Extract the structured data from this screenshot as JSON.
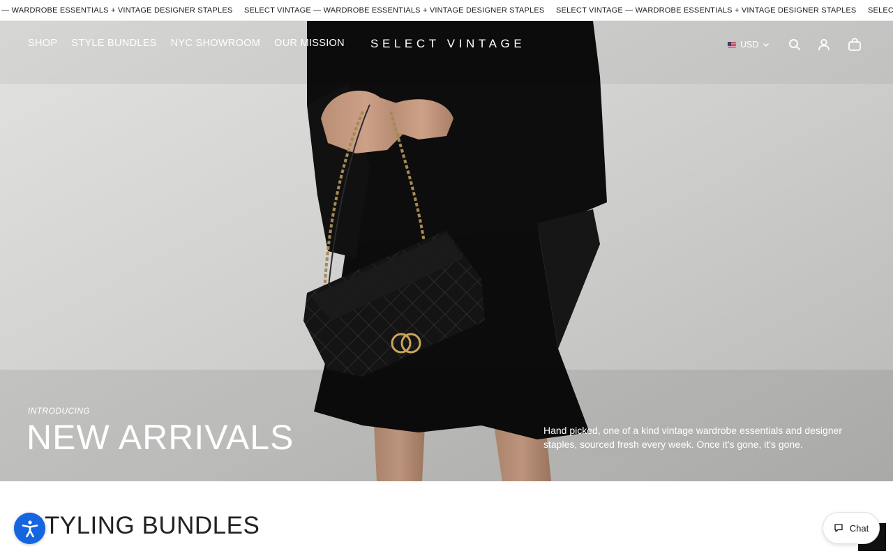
{
  "announcement": {
    "items": [
      "SELECT VINTAGE — WARDROBE ESSENTIALS + VINTAGE DESIGNER STAPLES",
      "SELECT VINTAGE — WARDROBE ESSENTIALS + VINTAGE DESIGNER STAPLES",
      "SELECT VINTAGE — WARDROBE ESSENTIALS + VINTAGE DESIGNER STAPLES",
      "SELECT VINTAGE — WARDROBE ESSENTIALS + VINTAGE DESIGNER STAPLES"
    ]
  },
  "header": {
    "nav": [
      "SHOP",
      "STYLE BUNDLES",
      "NYC SHOWROOM",
      "OUR MISSION"
    ],
    "logo": "SELECT VINTAGE",
    "currency": "USD",
    "icons": [
      "search-icon",
      "account-icon",
      "cart-icon"
    ]
  },
  "hero": {
    "eyebrow": "INTRODUCING",
    "title": "NEW ARRIVALS",
    "description": "Hand picked, one of a kind vintage wardrobe essentials and designer staples, sourced fresh every week. Once it's gone, it's gone."
  },
  "section": {
    "title": "STYLING BUNDLES"
  },
  "widgets": {
    "chat_label": "Chat"
  },
  "colors": {
    "text_on_hero": "#ffffff",
    "accessibility_button": "#1565e0",
    "dark": "#111111"
  }
}
